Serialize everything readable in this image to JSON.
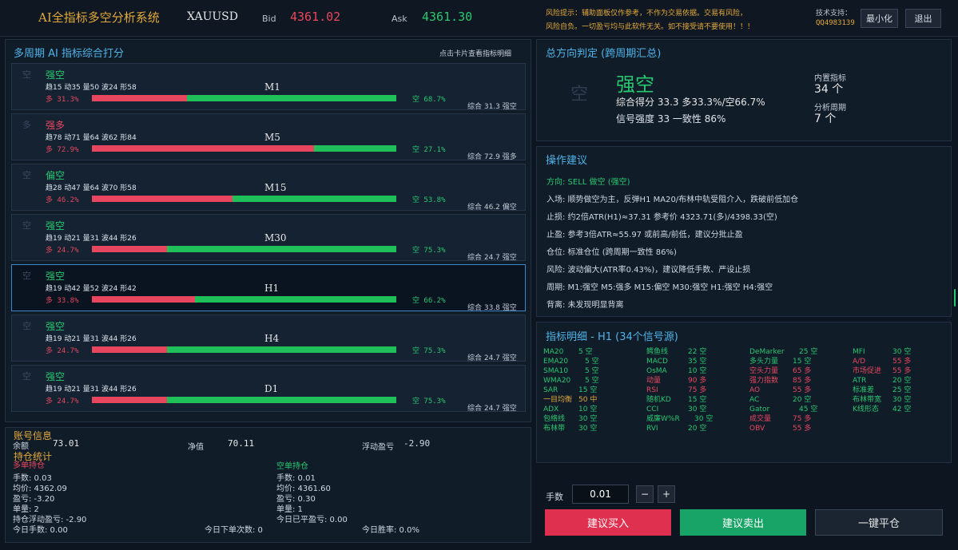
{
  "header": {
    "title": "AI全指标多空分析系统",
    "symbol": "XAUUSD",
    "bid_label": "Bid",
    "bid": "4361.02",
    "ask_label": "Ask",
    "ask": "4361.30",
    "risk_line1": "风险提示：辅助面板仅作参考，不作为交易依据。交易有风险，",
    "risk_line2": "风险自负。一切盈亏均与此软件无关。如不接受请不要使用！！！",
    "support_label": "技术支持：",
    "support_qq": "QQ4983139",
    "minimize": "最小化",
    "exit": "退出"
  },
  "multi_period": {
    "title": "多周期 AI 指标综合打分",
    "hint": "点击卡片查看指标明细",
    "cards": [
      {
        "period": "M1",
        "icon": "空",
        "verdict": "强空",
        "trend": "down",
        "sub": "趋15 动35 量50 波24 形58",
        "long_text": "多 31.3%",
        "long_pct": 31.3,
        "short_text": "空 68.7%",
        "summary": "综合 31.3 强空"
      },
      {
        "period": "M5",
        "icon": "多",
        "verdict": "强多",
        "trend": "up",
        "sub": "趋78 动71 量64 波62 形84",
        "long_text": "多 72.9%",
        "long_pct": 72.9,
        "short_text": "空 27.1%",
        "summary": "综合 72.9 强多"
      },
      {
        "period": "M15",
        "icon": "空",
        "verdict": "偏空",
        "trend": "down",
        "sub": "趋28 动47 量64 波70 形58",
        "long_text": "多 46.2%",
        "long_pct": 46.2,
        "short_text": "空 53.8%",
        "summary": "综合 46.2 偏空"
      },
      {
        "period": "M30",
        "icon": "空",
        "verdict": "强空",
        "trend": "down",
        "sub": "趋19 动21 量31 波44 形26",
        "long_text": "多 24.7%",
        "long_pct": 24.7,
        "short_text": "空 75.3%",
        "summary": "综合 24.7 强空"
      },
      {
        "period": "H1",
        "icon": "空",
        "verdict": "强空",
        "trend": "down",
        "sub": "趋19 动42 量52 波24 形42",
        "long_text": "多 33.8%",
        "long_pct": 33.8,
        "short_text": "空 66.2%",
        "summary": "综合 33.8 强空"
      },
      {
        "period": "H4",
        "icon": "空",
        "verdict": "强空",
        "trend": "down",
        "sub": "趋19 动21 量31 波44 形26",
        "long_text": "多 24.7%",
        "long_pct": 24.7,
        "short_text": "空 75.3%",
        "summary": "综合 24.7 强空"
      },
      {
        "period": "D1",
        "icon": "空",
        "verdict": "强空",
        "trend": "down",
        "sub": "趋19 动21 量31 波44 形26",
        "long_text": "多 24.7%",
        "long_pct": 24.7,
        "short_text": "空 75.3%",
        "summary": "综合 24.7 强空"
      }
    ],
    "active_period": "H1"
  },
  "account": {
    "title": "账号信息",
    "balance_label": "余额",
    "balance": "73.01",
    "equity_label": "净值",
    "equity": "70.11",
    "floating_label": "浮动盈亏",
    "floating": "-2.90",
    "positions_title": "持仓统计",
    "long_title": "多单持仓",
    "long_lots": "手数: 0.03",
    "long_avg": "均价: 4362.09",
    "long_profit": "盈亏: -3.20",
    "long_count": "单量: 2",
    "long_float": "持仓浮动盈亏: -2.90",
    "today_lots": "今日手数: 0.00",
    "short_title": "空单持仓",
    "short_lots": "手数: 0.01",
    "short_avg": "均价: 4361.60",
    "short_profit": "盈亏: 0.30",
    "short_count": "单量: 1",
    "today_closed": "今日已平盈亏: 0.00",
    "today_orders": "今日下单次数: 0",
    "today_winrate": "今日胜率: 0.0%"
  },
  "direction": {
    "title": "总方向判定 (跨周期汇总)",
    "icon": "空",
    "verdict": "强空",
    "score": "综合得分 33.3  多33.3%/空66.7%",
    "strength": "信号强度 33  一致性 86%",
    "builtin_label": "内置指标",
    "builtin_value": "34 个",
    "periods_label": "分析周期",
    "periods_value": "7 个"
  },
  "advice": {
    "title": "操作建议",
    "lines": [
      "方向: SELL 做空 (强空)",
      "入场: 顺势做空为主，反弹H1 MA20/布林中轨受阻介入，跌破前低加仓",
      "止损: 约2倍ATR(H1)≈37.31  参考价 4323.71(多)/4398.33(空)",
      "止盈: 参考3倍ATR≈55.97 或前高/前低，建议分批止盈",
      "仓位: 标准仓位 (跨周期一致性 86%)",
      "风险: 波动偏大(ATR率0.43%)，建议降低手数、严设止损",
      "周期: M1:强空 M5:强多 M15:偏空       M30:强空 H1:强空 H4:强空",
      "背离: 未发现明显背离"
    ]
  },
  "indicators": {
    "title": "指标明细 - H1  (34个信号源)",
    "columns": [
      [
        {
          "name": "MA20",
          "value": "5 空",
          "trend": "down"
        },
        {
          "name": "EMA20",
          "value": "5 空",
          "trend": "down"
        },
        {
          "name": "SMA10",
          "value": "5 空",
          "trend": "down"
        },
        {
          "name": "WMA20",
          "value": "5 空",
          "trend": "down"
        },
        {
          "name": "SAR",
          "value": "15 空",
          "trend": "down"
        },
        {
          "name": "一目均衡",
          "value": "50 中",
          "trend": "neutral"
        },
        {
          "name": "ADX",
          "value": "10 空",
          "trend": "down"
        },
        {
          "name": "包络线",
          "value": "30 空",
          "trend": "down"
        },
        {
          "name": "布林带",
          "value": "30 空",
          "trend": "down"
        }
      ],
      [
        {
          "name": "鳄鱼线",
          "value": "22 空",
          "trend": "down"
        },
        {
          "name": "MACD",
          "value": "35 空",
          "trend": "down"
        },
        {
          "name": "OsMA",
          "value": "10 空",
          "trend": "down"
        },
        {
          "name": "动量",
          "value": "90 多",
          "trend": "up"
        },
        {
          "name": "RSI",
          "value": "75 多",
          "trend": "up"
        },
        {
          "name": "随机KD",
          "value": "15 空",
          "trend": "down"
        },
        {
          "name": "CCI",
          "value": "30 空",
          "trend": "down"
        },
        {
          "name": "威廉W%R",
          "value": "30 空",
          "trend": "down"
        },
        {
          "name": "RVI",
          "value": "20 空",
          "trend": "down"
        }
      ],
      [
        {
          "name": "DeMarker",
          "value": "25 空",
          "trend": "down"
        },
        {
          "name": "多头力量",
          "value": "15 空",
          "trend": "down"
        },
        {
          "name": "空头力量",
          "value": "65 多",
          "trend": "up"
        },
        {
          "name": "强力指数",
          "value": "85 多",
          "trend": "up"
        },
        {
          "name": "AO",
          "value": "55 多",
          "trend": "up"
        },
        {
          "name": "AC",
          "value": "20 空",
          "trend": "down"
        },
        {
          "name": "Gator",
          "value": "45 空",
          "trend": "down"
        },
        {
          "name": "成交量",
          "value": "75 多",
          "trend": "up"
        },
        {
          "name": "OBV",
          "value": "55 多",
          "trend": "up"
        }
      ],
      [
        {
          "name": "MFI",
          "value": "30 空",
          "trend": "down"
        },
        {
          "name": "A/D",
          "value": "55 多",
          "trend": "up"
        },
        {
          "name": "市场促进",
          "value": "55 多",
          "trend": "up"
        },
        {
          "name": "ATR",
          "value": "20 空",
          "trend": "down"
        },
        {
          "name": "标准差",
          "value": "25 空",
          "trend": "down"
        },
        {
          "name": "布林带宽",
          "value": "30 空",
          "trend": "down"
        },
        {
          "name": "K线形态",
          "value": "42 空",
          "trend": "down"
        }
      ]
    ]
  },
  "trade": {
    "lots_label": "手数",
    "lots_value": "0.01",
    "minus": "−",
    "plus": "+",
    "buy": "建议买入",
    "sell": "建议卖出",
    "close_all": "一键平仓"
  },
  "colors": {
    "up": "#e7475e",
    "down": "#28c76f",
    "neutral": "#e2a93b",
    "accent": "#4fb3e8",
    "title_gold": "#e2a93b"
  }
}
